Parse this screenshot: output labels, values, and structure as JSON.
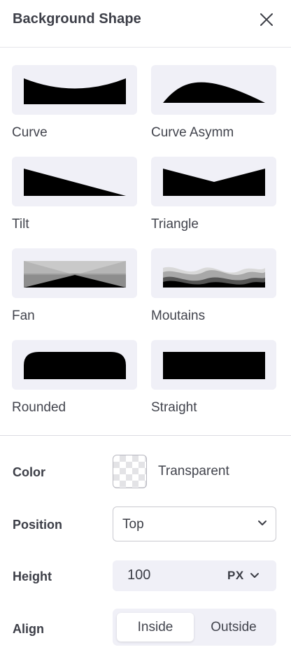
{
  "header": {
    "title": "Background Shape"
  },
  "shapes": [
    {
      "label": "Curve",
      "icon": "curve-shape"
    },
    {
      "label": "Curve Asymm",
      "icon": "curve-asymm-shape"
    },
    {
      "label": "Tilt",
      "icon": "tilt-shape"
    },
    {
      "label": "Triangle",
      "icon": "triangle-shape"
    },
    {
      "label": "Fan",
      "icon": "fan-shape"
    },
    {
      "label": "Moutains",
      "icon": "mountains-shape"
    },
    {
      "label": "Rounded",
      "icon": "rounded-shape"
    },
    {
      "label": "Straight",
      "icon": "straight-shape"
    }
  ],
  "settings": {
    "color": {
      "label": "Color",
      "value": "Transparent"
    },
    "position": {
      "label": "Position",
      "value": "Top"
    },
    "height": {
      "label": "Height",
      "value": "100",
      "unit": "PX"
    },
    "align": {
      "label": "Align",
      "options": [
        "Inside",
        "Outside"
      ],
      "selected": "Inside"
    }
  },
  "colors": {
    "thumb_bg": "#f0f0f7",
    "text": "#3b3d45",
    "divider": "#dcdce2"
  }
}
